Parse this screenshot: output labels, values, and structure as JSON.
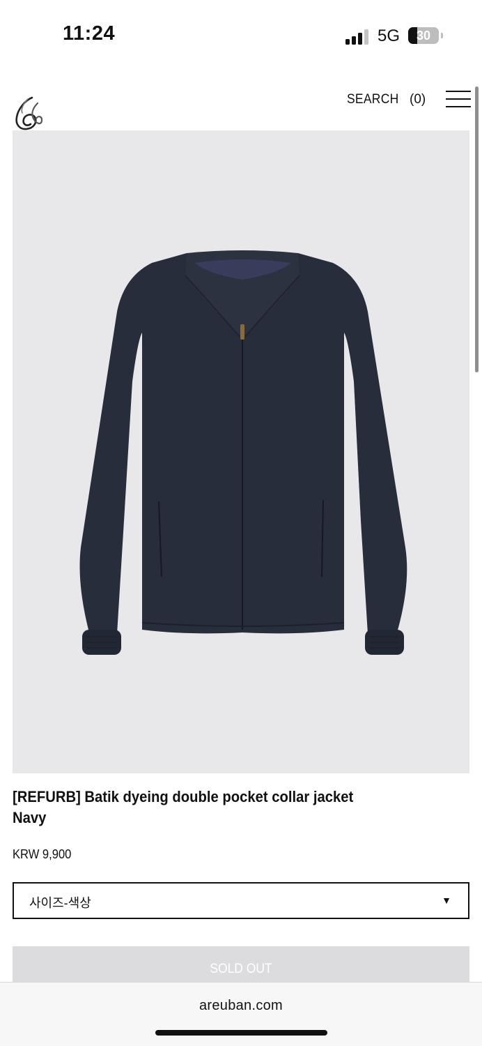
{
  "status_bar": {
    "time": "11:24",
    "network": "5G",
    "battery_level": "30",
    "battery_percent": 30
  },
  "header": {
    "logo_icon": "brand-logo-icon",
    "search_label": "SEARCH",
    "cart_label": "(0)",
    "menu_icon": "hamburger-menu-icon"
  },
  "product": {
    "image_alt_icon": "navy-collar-jacket-image",
    "title_line1": "[REFURB] Batik dyeing double pocket collar jacket",
    "title_line2": "Navy",
    "price": "KRW 9,900",
    "option_placeholder": "사이즈-색상",
    "option_arrow": "▼",
    "sold_out_label": "SOLD OUT"
  },
  "browser": {
    "url": "areuban.com"
  },
  "colors": {
    "image_background": "#e8e8ea",
    "jacket_navy": "#272d3a",
    "sold_out_background": "#dcdcdf"
  }
}
